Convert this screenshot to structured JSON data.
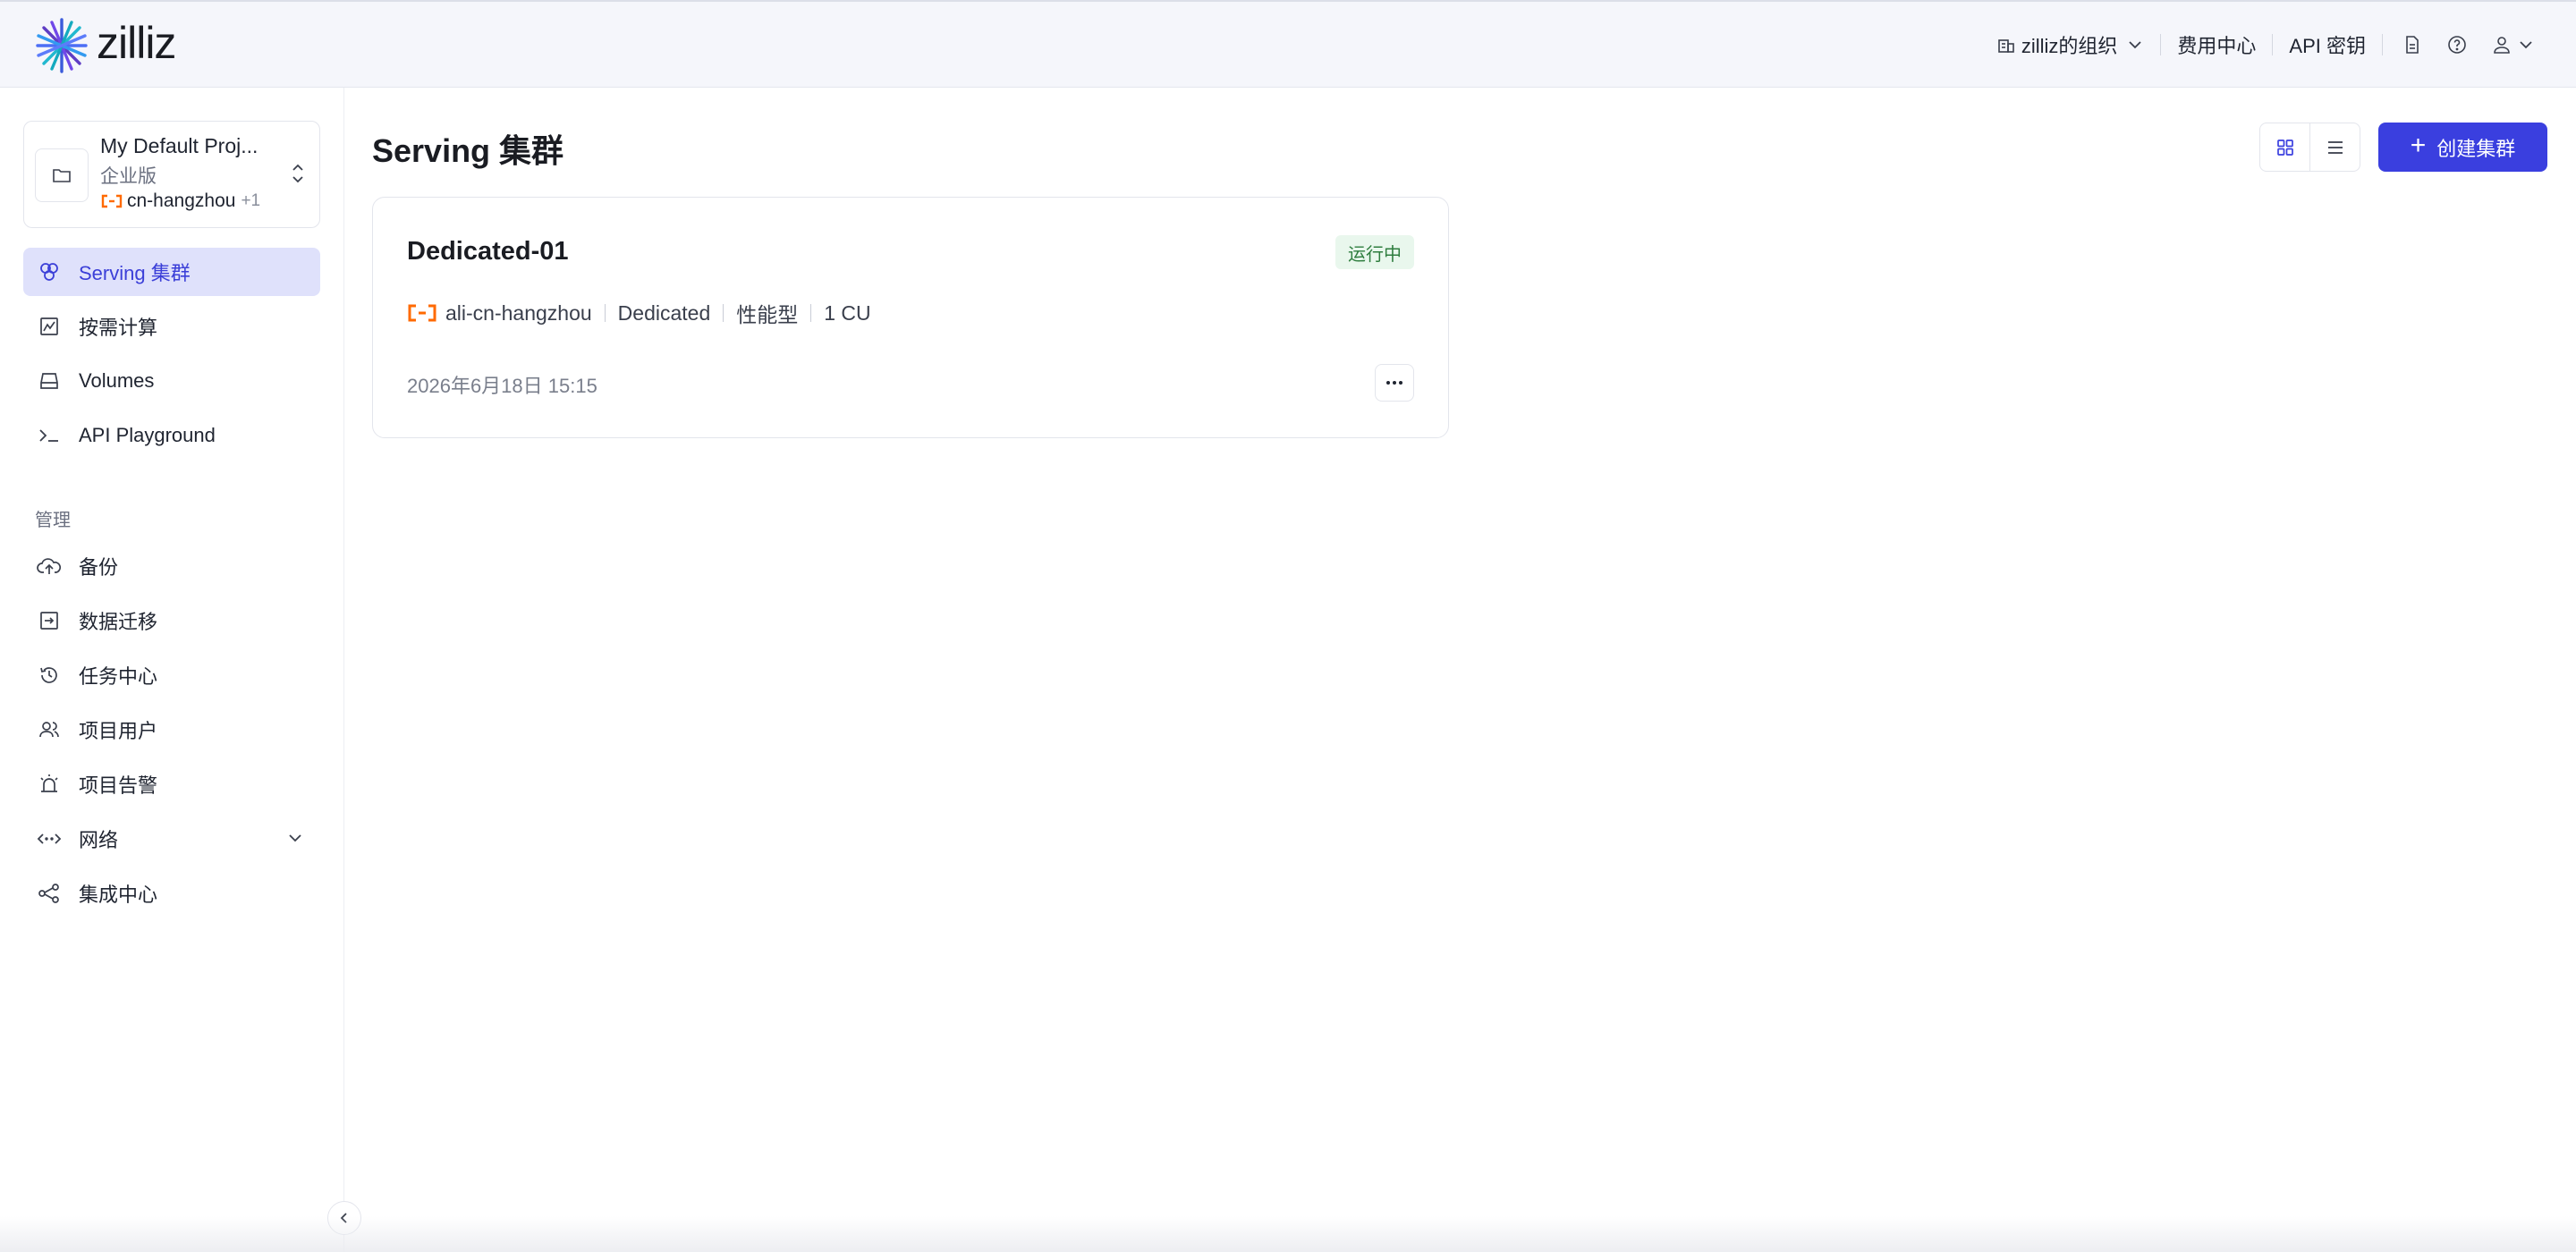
{
  "header": {
    "logo_text": "zilliz",
    "org_label": "zilliz的组织",
    "billing_label": "费用中心",
    "api_key_label": "API 密钥"
  },
  "project": {
    "name": "My Default Proj...",
    "plan": "企业版",
    "region": "cn-hangzhou",
    "region_more": "+1"
  },
  "sidebar": {
    "items": [
      {
        "label": "Serving 集群",
        "icon": "clusters-icon",
        "active": true
      },
      {
        "label": "按需计算",
        "icon": "compute-chart-icon"
      },
      {
        "label": "Volumes",
        "icon": "volume-drive-icon"
      },
      {
        "label": "API Playground",
        "icon": "terminal-icon"
      }
    ],
    "section_label": "管理",
    "manage_items": [
      {
        "label": "备份",
        "icon": "cloud-upload-icon"
      },
      {
        "label": "数据迁移",
        "icon": "migrate-icon"
      },
      {
        "label": "任务中心",
        "icon": "history-icon"
      },
      {
        "label": "项目用户",
        "icon": "users-icon"
      },
      {
        "label": "项目告警",
        "icon": "alarm-icon"
      },
      {
        "label": "网络",
        "icon": "network-icon"
      },
      {
        "label": "集成中心",
        "icon": "share-nodes-icon"
      }
    ]
  },
  "main": {
    "title": "Serving 集群",
    "create_label": "创建集群",
    "clusters": [
      {
        "name": "Dedicated-01",
        "status": "运行中",
        "region": "ali-cn-hangzhou",
        "type": "Dedicated",
        "profile": "性能型",
        "cu": "1 CU",
        "created": "2026年6月18日 15:15"
      }
    ]
  },
  "colors": {
    "accent": "#3a3fdf",
    "active_bg": "#dfe1fb",
    "status_bg": "#e9f7ed",
    "status_text": "#2e7d3e",
    "alibaba_orange": "#ff6a00"
  }
}
